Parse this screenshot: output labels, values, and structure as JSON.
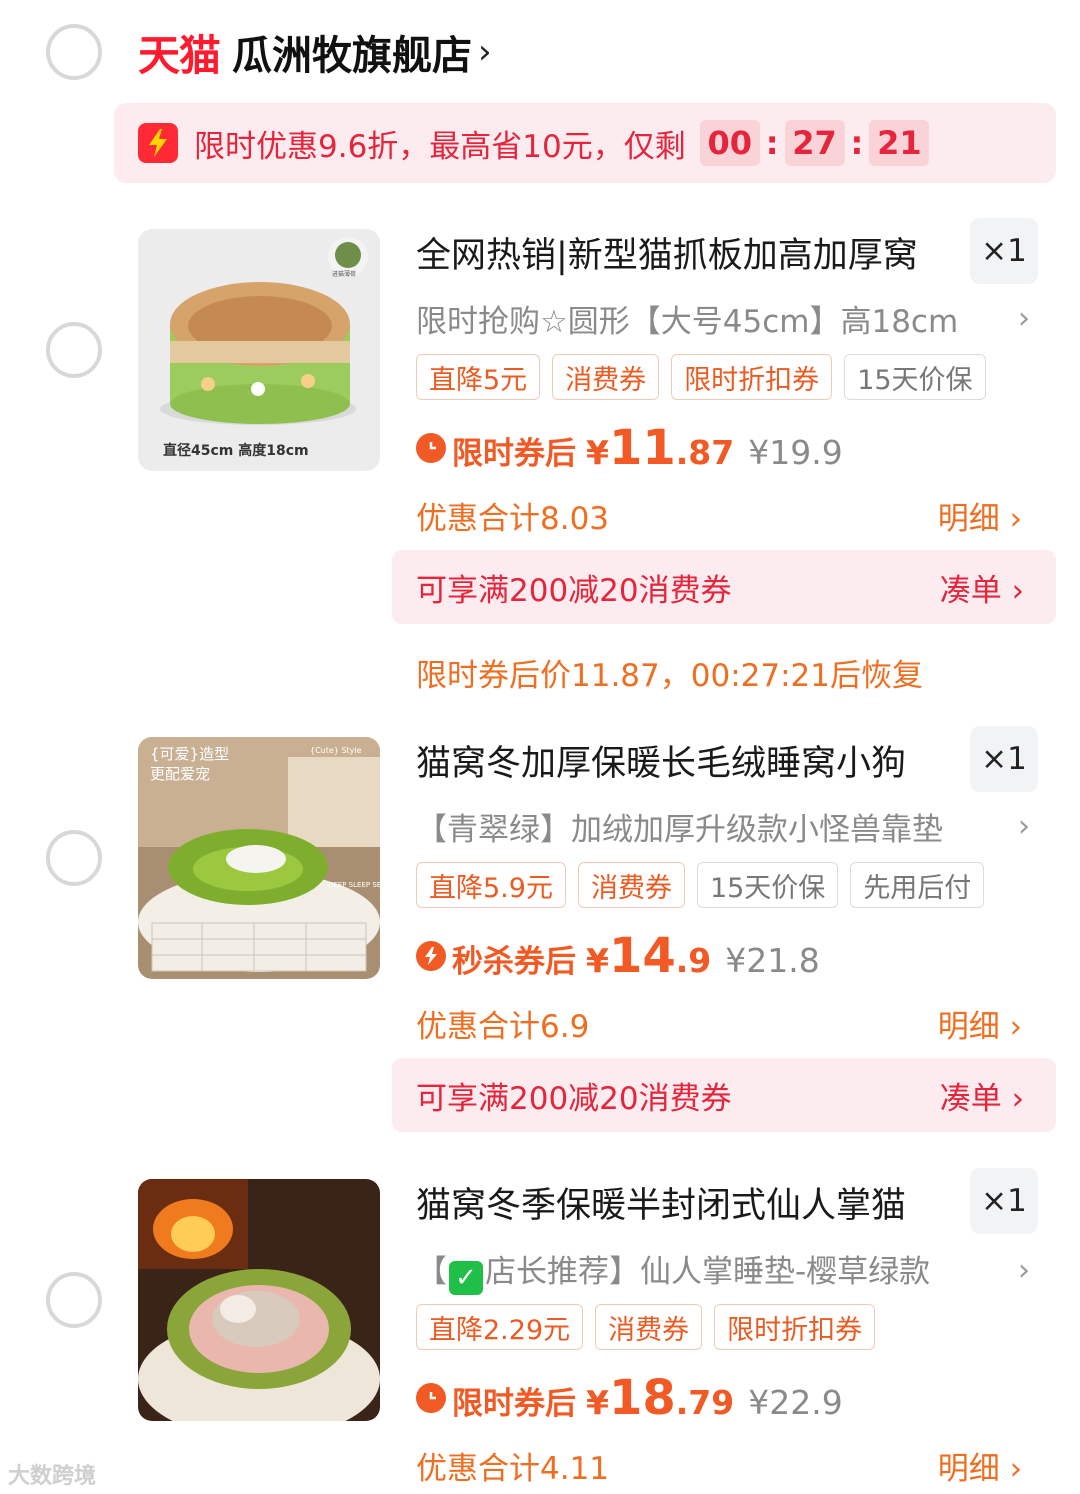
{
  "store": {
    "brand": "天猫",
    "name": "瓜洲牧旗舰店",
    "arrow": "›"
  },
  "banner": {
    "text": "限时优惠9.6折，最高省10元，仅剩",
    "countdown": [
      "00",
      "27",
      "21"
    ],
    "sep": ":"
  },
  "products": [
    {
      "title": "全网热销|新型猫抓板加高加厚窝",
      "qty": "×1",
      "sku": "限时抢购☆圆形【大号45cm】高18cm",
      "tags": [
        "直降5元",
        "消费券",
        "限时折扣券",
        "15天价保"
      ],
      "price_label": "限时券后",
      "currency": "¥",
      "price_int": "11",
      "price_dec": ".87",
      "orig_price": "¥19.9",
      "savings": "优惠合计8.03",
      "detail": "明细",
      "coupon": "可享满200减20消费券",
      "coupon_action": "凑单",
      "recover": "限时券后价11.87，00:27:21后恢复",
      "image_caption": "直径45cm  高度18cm",
      "image_badge": "进猫薄荷"
    },
    {
      "title": "猫窝冬加厚保暖长毛绒睡窝小狗",
      "qty": "×1",
      "sku": "【青翠绿】加绒加厚升级款小怪兽靠垫",
      "tags": [
        "直降5.9元",
        "消费券",
        "15天价保",
        "先用后付"
      ],
      "price_label": "秒杀券后",
      "currency": "¥",
      "price_int": "14",
      "price_dec": ".9",
      "orig_price": "¥21.8",
      "savings": "优惠合计6.9",
      "detail": "明细",
      "coupon": "可享满200减20消费券",
      "coupon_action": "凑单",
      "image_caption": "{可爱}造型",
      "image_caption2": "更配爱宠",
      "image_caption3": "{Cute} Style",
      "image_caption4": "DEEP SLEEP SERIES"
    },
    {
      "title": "猫窝冬季保暖半封闭式仙人掌猫",
      "qty": "×1",
      "sku_prefix": "【",
      "sku": "店长推荐】仙人掌睡垫-樱草绿款",
      "tags": [
        "直降2.29元",
        "消费券",
        "限时折扣券"
      ],
      "price_label": "限时券后",
      "currency": "¥",
      "price_int": "18",
      "price_dec": ".79",
      "orig_price": "¥22.9",
      "savings": "优惠合计4.11",
      "detail": "明细"
    }
  ],
  "watermark": "大数跨境",
  "colors": {
    "accent": "#f15a24",
    "brand_red": "#ff1a2e",
    "banner_bg": "#fdecef"
  }
}
